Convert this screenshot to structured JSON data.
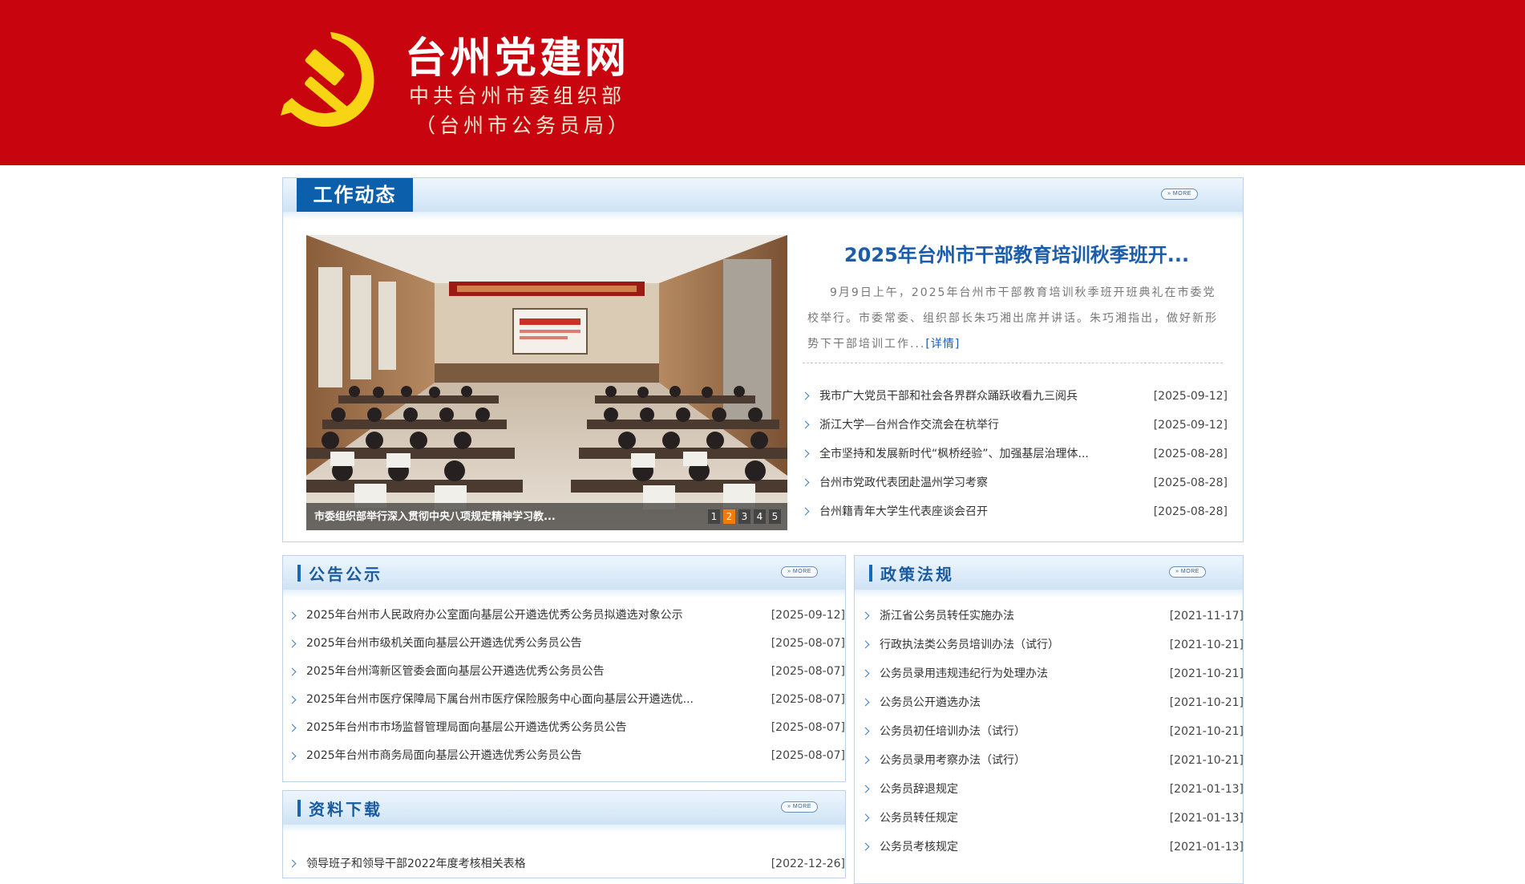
{
  "header": {
    "site_title": "台州党建网",
    "org_name": "中共台州市委组织部",
    "org_alias": "（台州市公务员局）"
  },
  "colors": {
    "header_red": "#c8050f",
    "accent_blue": "#0b5fab",
    "emblem_gold": "#f7d515",
    "active_orange": "#f37b0d"
  },
  "icons": {
    "emblem": "hammer-sickle-icon",
    "list_bullet": "chevron-right-icon"
  },
  "more_label": "» MORE",
  "work_news": {
    "title": "工作动态",
    "photo_caption": "市委组织部举行深入贯彻中央八项规定精神学习教...",
    "pager": [
      "1",
      "2",
      "3",
      "4",
      "5"
    ],
    "pager_active": "2",
    "lead_title": "2025年台州市干部教育培训秋季班开...",
    "lead_summary": "9月9日上午，2025年台州市干部教育培训秋季班开班典礼在市委党校举行。市委常委、组织部长朱巧湘出席并讲话。朱巧湘指出，做好新形势下干部培训工作...",
    "lead_more": "[详情]",
    "items": [
      {
        "title": "我市广大党员干部和社会各界群众踊跃收看九三阅兵",
        "date": "[2025-09-12]"
      },
      {
        "title": "浙江大学—台州合作交流会在杭举行",
        "date": "[2025-09-12]"
      },
      {
        "title": "全市坚持和发展新时代“枫桥经验”、加强基层治理体...",
        "date": "[2025-08-28]"
      },
      {
        "title": "台州市党政代表团赴温州学习考察",
        "date": "[2025-08-28]"
      },
      {
        "title": "台州籍青年大学生代表座谈会召开",
        "date": "[2025-08-28]"
      }
    ]
  },
  "notices": {
    "title": "公告公示",
    "items": [
      {
        "title": "2025年台州市人民政府办公室面向基层公开遴选优秀公务员拟遴选对象公示",
        "date": "[2025-09-12]"
      },
      {
        "title": "2025年台州市级机关面向基层公开遴选优秀公务员公告",
        "date": "[2025-08-07]"
      },
      {
        "title": "2025年台州湾新区管委会面向基层公开遴选优秀公务员公告",
        "date": "[2025-08-07]"
      },
      {
        "title": "2025年台州市医疗保障局下属台州市医疗保险服务中心面向基层公开遴选优...",
        "date": "[2025-08-07]"
      },
      {
        "title": "2025年台州市市场监督管理局面向基层公开遴选优秀公务员公告",
        "date": "[2025-08-07]"
      },
      {
        "title": "2025年台州市商务局面向基层公开遴选优秀公务员公告",
        "date": "[2025-08-07]"
      }
    ]
  },
  "downloads": {
    "title": "资料下载",
    "items": [
      {
        "title": "领导班子和领导干部2022年度考核相关表格",
        "date": "[2022-12-26]"
      }
    ]
  },
  "policies": {
    "title": "政策法规",
    "items": [
      {
        "title": "浙江省公务员转任实施办法",
        "date": "[2021-11-17]"
      },
      {
        "title": "行政执法类公务员培训办法（试行）",
        "date": "[2021-10-21]"
      },
      {
        "title": "公务员录用违规违纪行为处理办法",
        "date": "[2021-10-21]"
      },
      {
        "title": "公务员公开遴选办法",
        "date": "[2021-10-21]"
      },
      {
        "title": "公务员初任培训办法（试行）",
        "date": "[2021-10-21]"
      },
      {
        "title": "公务员录用考察办法（试行）",
        "date": "[2021-10-21]"
      },
      {
        "title": "公务员辞退规定",
        "date": "[2021-01-13]"
      },
      {
        "title": "公务员转任规定",
        "date": "[2021-01-13]"
      },
      {
        "title": "公务员考核规定",
        "date": "[2021-01-13]"
      }
    ]
  }
}
